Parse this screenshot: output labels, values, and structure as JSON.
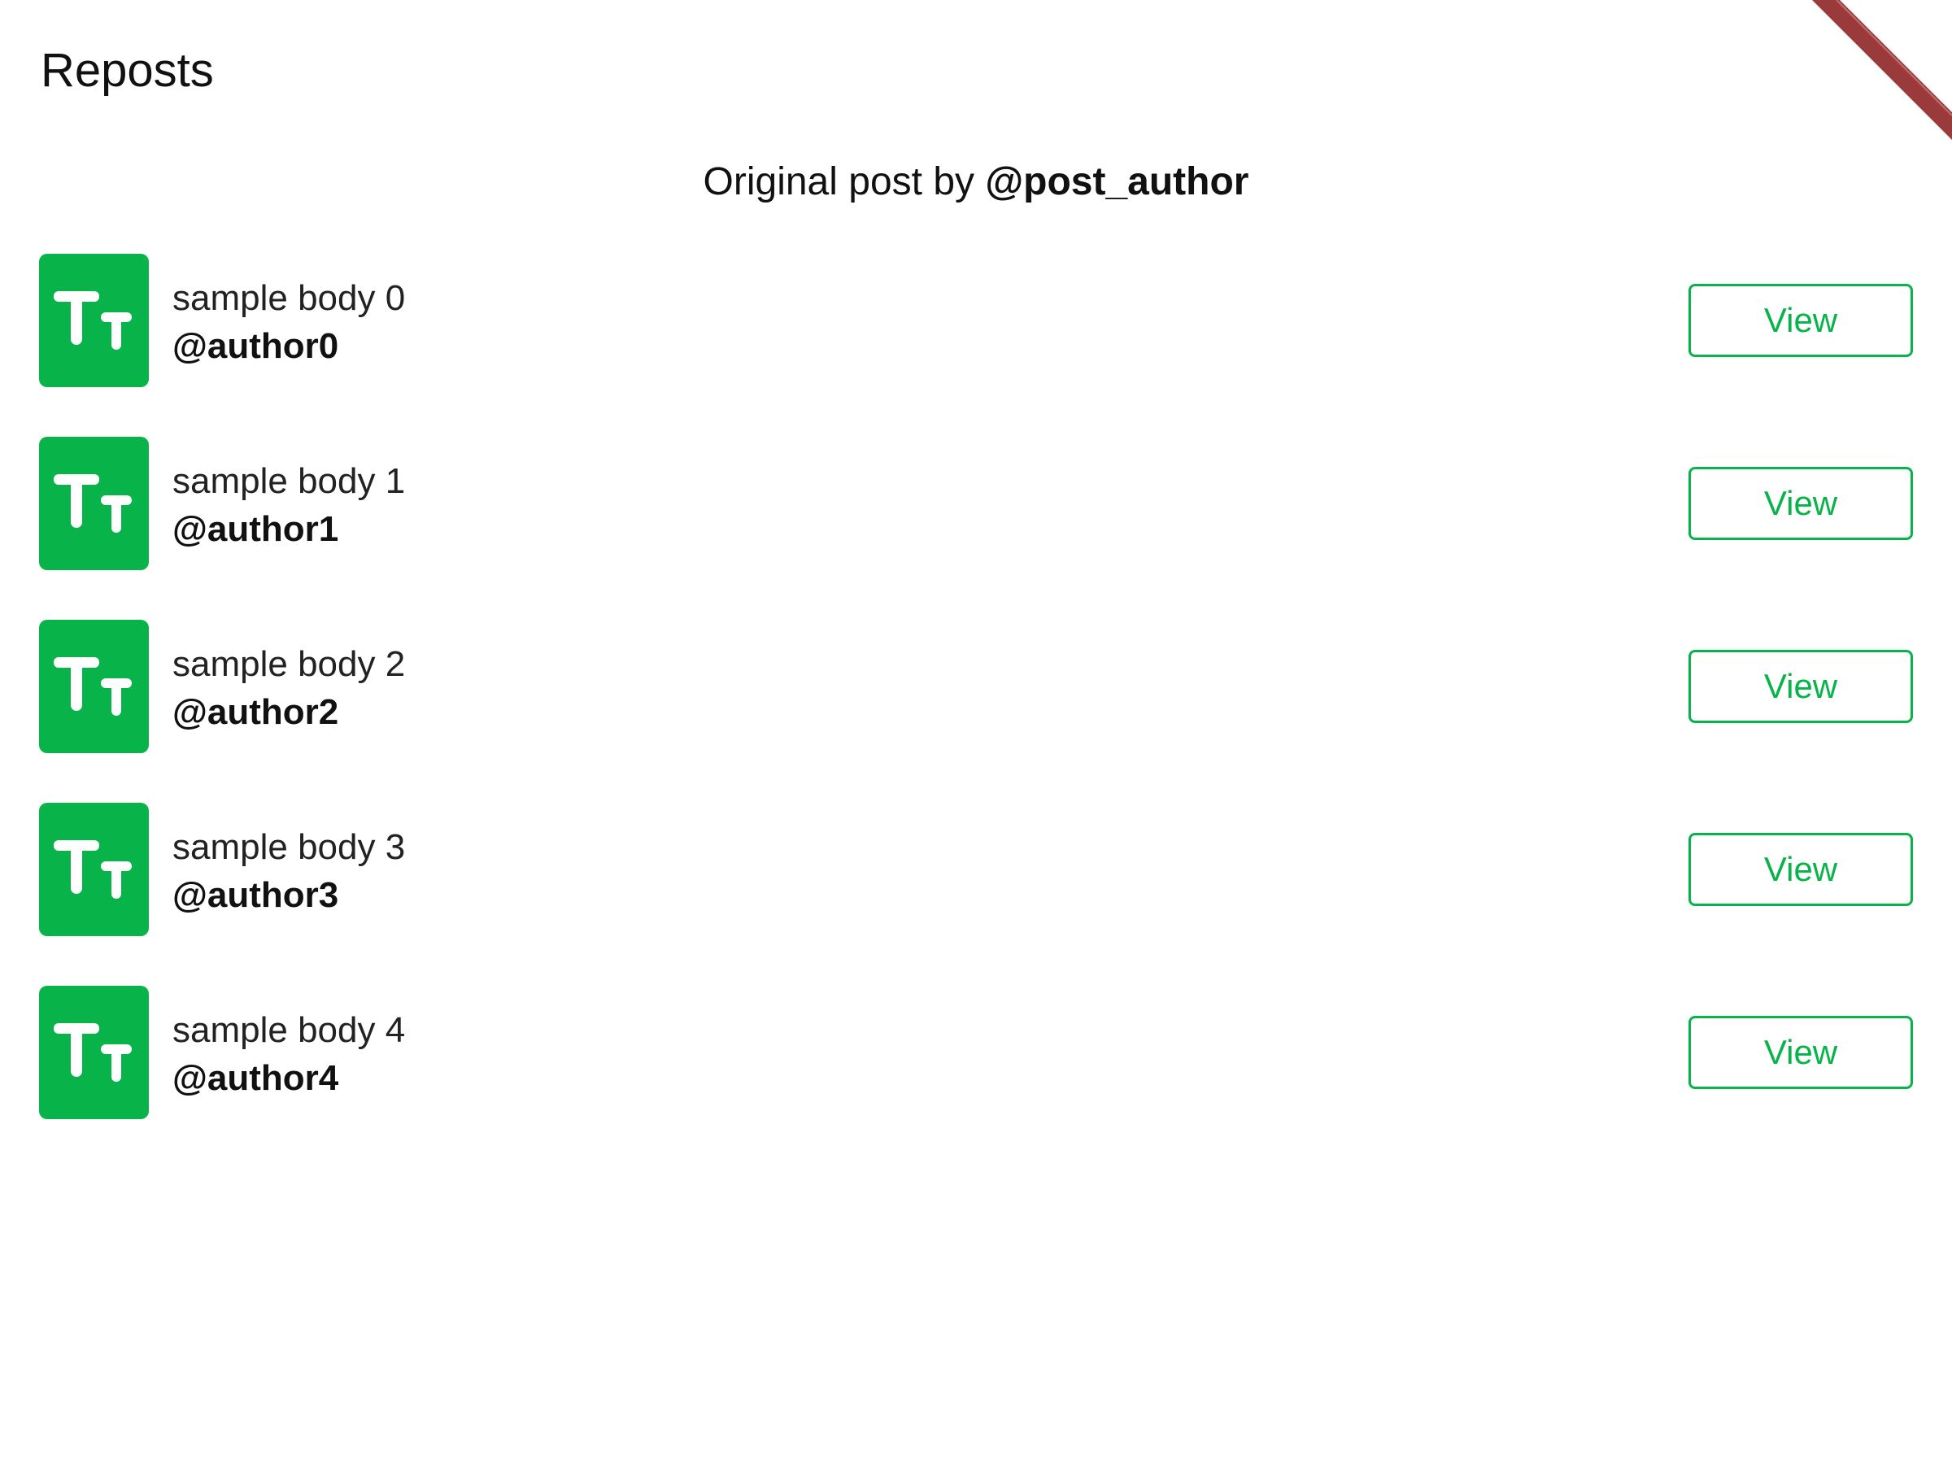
{
  "header": {
    "title": "Reposts"
  },
  "original_post": {
    "prefix": "Original post by ",
    "author": "@post_author"
  },
  "reposts": [
    {
      "body": "sample body 0",
      "author": "@author0",
      "button_label": "View"
    },
    {
      "body": "sample body 1",
      "author": "@author1",
      "button_label": "View"
    },
    {
      "body": "sample body 2",
      "author": "@author2",
      "button_label": "View"
    },
    {
      "body": "sample body 3",
      "author": "@author3",
      "button_label": "View"
    },
    {
      "body": "sample body 4",
      "author": "@author4",
      "button_label": "View"
    }
  ],
  "colors": {
    "accent": "#08b44a",
    "ribbon": "#9b3a3a"
  },
  "icons": {
    "avatar": "text-size-icon"
  }
}
